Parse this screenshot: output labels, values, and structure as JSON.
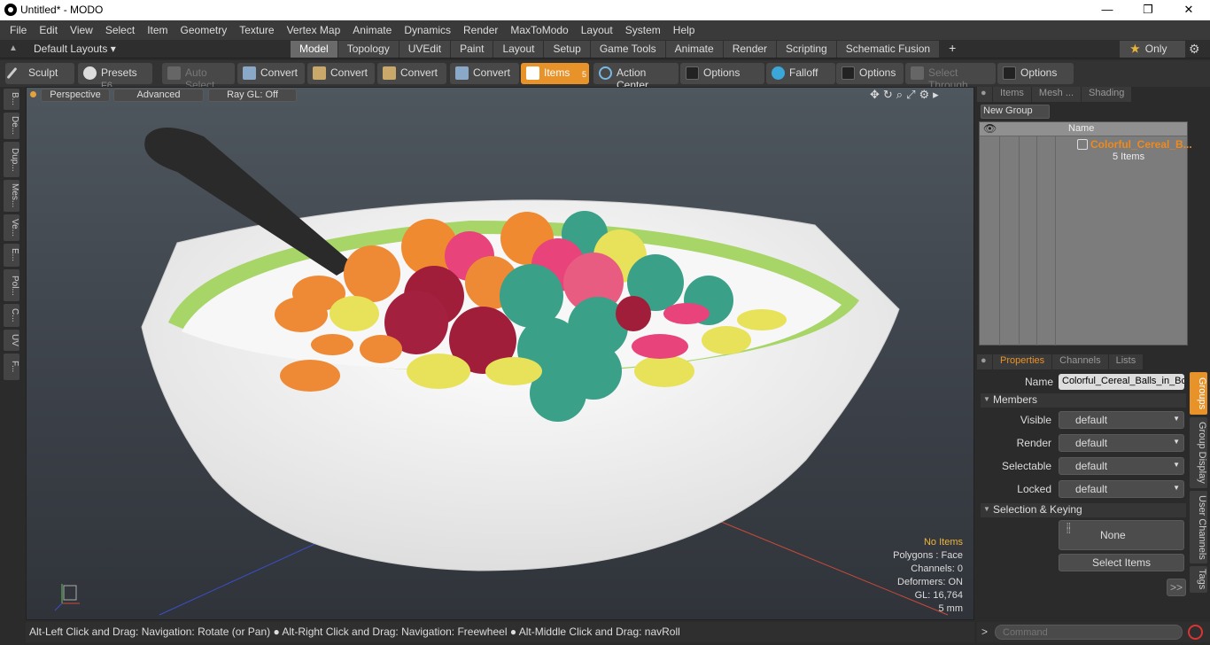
{
  "window": {
    "title": "Untitled* - MODO",
    "minimize": "—",
    "maximize": "❐",
    "close": "✕"
  },
  "menu": [
    "File",
    "Edit",
    "View",
    "Select",
    "Item",
    "Geometry",
    "Texture",
    "Vertex Map",
    "Animate",
    "Dynamics",
    "Render",
    "MaxToModo",
    "Layout",
    "System",
    "Help"
  ],
  "layouts": {
    "default": "Default Layouts ▾",
    "tabs": [
      "Model",
      "Topology",
      "UVEdit",
      "Paint",
      "Layout",
      "Setup",
      "Game Tools",
      "Animate",
      "Render",
      "Scripting",
      "Schematic Fusion"
    ],
    "active": "Model",
    "add": "+",
    "only": "Only",
    "star": "★",
    "gear": "⚙"
  },
  "toolbar": {
    "sculpt": "Sculpt",
    "presets": "Presets",
    "presets_key": "F6",
    "auto_select": "Auto Select",
    "convert1": "Convert",
    "convert2": "Convert",
    "convert3": "Convert",
    "convert4": "Convert",
    "items": "Items",
    "items_key": "5",
    "action_center": "Action Center",
    "options1": "Options",
    "falloff": "Falloff",
    "options2": "Options",
    "select_through": "Select Through",
    "options3": "Options"
  },
  "leftrail": [
    "B...",
    "De...",
    "Dup...",
    "Mes...",
    "Ve...",
    "E...",
    "Pol...",
    "C...",
    "UV",
    "F..."
  ],
  "viewport": {
    "perspective": "Perspective",
    "advanced": "Advanced",
    "raygl": "Ray GL: Off",
    "info": {
      "no_items": "No Items",
      "polygons": "Polygons : Face",
      "channels": "Channels: 0",
      "deformers": "Deformers: ON",
      "gl": "GL: 16,764",
      "scale": "5 mm"
    },
    "colors": {
      "noitems": "#f0b43a"
    }
  },
  "status": "Alt-Left Click and Drag: Navigation: Rotate (or Pan) ● Alt-Right Click and Drag: Navigation: Freewheel ● Alt-Middle Click and Drag: navRoll",
  "items_panel": {
    "tabs": [
      "Items",
      "Mesh ...",
      "Shading"
    ],
    "new_group": "New Group",
    "col_name": "Name",
    "group_name": "Colorful_Cereal_B...",
    "group_count": "5 Items"
  },
  "properties": {
    "tabs": [
      "Properties",
      "Channels",
      "Lists"
    ],
    "name_label": "Name",
    "name_value": "Colorful_Cereal_Balls_in_Bc",
    "members": "Members",
    "rows": [
      {
        "label": "Visible",
        "value": "default"
      },
      {
        "label": "Render",
        "value": "default"
      },
      {
        "label": "Selectable",
        "value": "default"
      },
      {
        "label": "Locked",
        "value": "default"
      }
    ],
    "selection_keying": "Selection & Keying",
    "none": "None",
    "select_items": "Select Items",
    "more": ">>",
    "vtabs": [
      "Groups",
      "Group Display",
      "User Channels",
      "Tags"
    ]
  },
  "command": {
    "placeholder": "Command",
    "prompt": ">"
  }
}
